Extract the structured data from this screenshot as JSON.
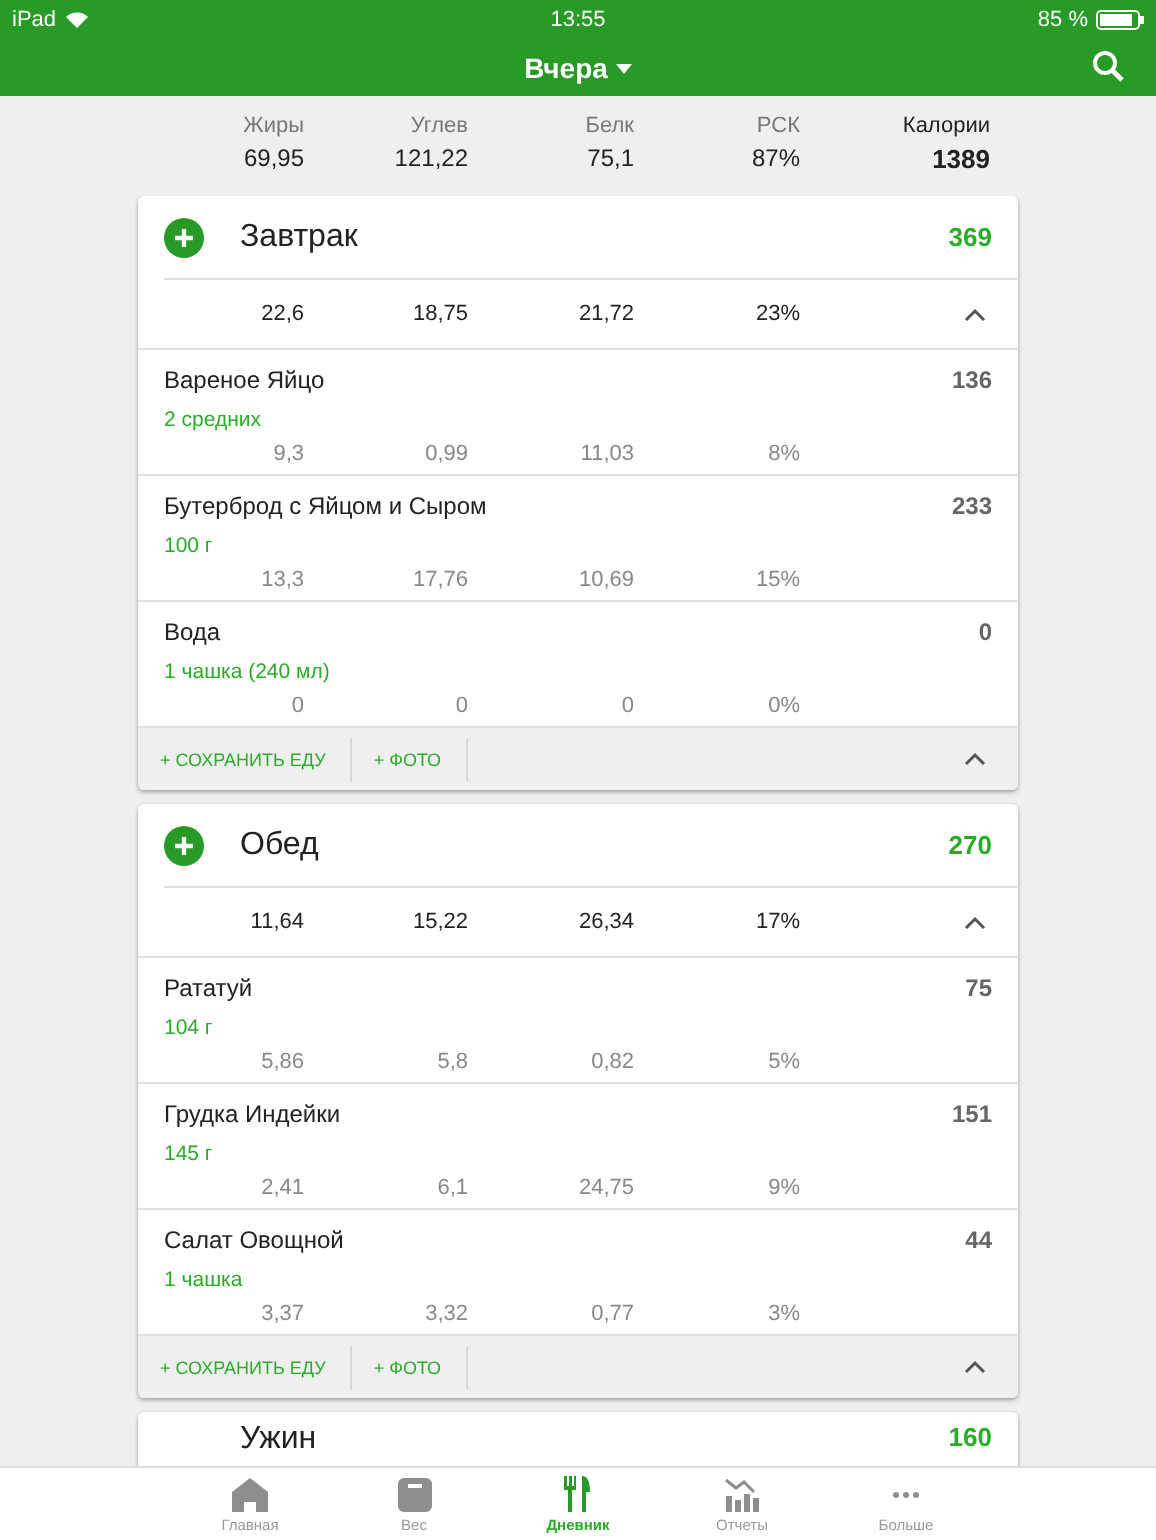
{
  "status_bar": {
    "device": "iPad",
    "time": "13:55",
    "battery": "85 %"
  },
  "header": {
    "title": "Вчера"
  },
  "summary": [
    {
      "kind": "macro",
      "label": "Жиры",
      "value": "69,95"
    },
    {
      "kind": "macro",
      "label": "Углев",
      "value": "121,22"
    },
    {
      "kind": "macro",
      "label": "Белк",
      "value": "75,1"
    },
    {
      "kind": "macro",
      "label": "РСК",
      "value": "87%"
    },
    {
      "kind": "calories",
      "label": "Калории",
      "value": "1389"
    }
  ],
  "meals": [
    {
      "name": "Завтрак",
      "calories": "369",
      "totals": [
        "22,6",
        "18,75",
        "21,72",
        "23%"
      ],
      "expanded": true,
      "items": [
        {
          "name": "Вареное Яйцо",
          "serving": "2 средних",
          "calories": "136",
          "values": [
            "9,3",
            "0,99",
            "11,03",
            "8%"
          ]
        },
        {
          "name": "Бутерброд с Яйцом и Сыром",
          "serving": "100 г",
          "calories": "233",
          "values": [
            "13,3",
            "17,76",
            "10,69",
            "15%"
          ]
        },
        {
          "name": "Вода",
          "serving": "1 чашка (240 мл)",
          "calories": "0",
          "values": [
            "0",
            "0",
            "0",
            "0%"
          ]
        }
      ],
      "actions": [
        "+ СОХРАНИТЬ ЕДУ",
        "+ ФОТО"
      ]
    },
    {
      "name": "Обед",
      "calories": "270",
      "totals": [
        "11,64",
        "15,22",
        "26,34",
        "17%"
      ],
      "expanded": true,
      "items": [
        {
          "name": "Рататуй",
          "serving": "104 г",
          "calories": "75",
          "values": [
            "5,86",
            "5,8",
            "0,82",
            "5%"
          ]
        },
        {
          "name": "Грудка Индейки",
          "serving": "145 г",
          "calories": "151",
          "values": [
            "2,41",
            "6,1",
            "24,75",
            "9%"
          ]
        },
        {
          "name": "Салат Овощной",
          "serving": "1 чашка",
          "calories": "44",
          "values": [
            "3,37",
            "3,32",
            "0,77",
            "3%"
          ]
        }
      ],
      "actions": [
        "+ СОХРАНИТЬ ЕДУ",
        "+ ФОТО"
      ]
    },
    {
      "name": "Ужин",
      "calories": "160"
    }
  ],
  "tab_bar": [
    {
      "kind": "home",
      "label": "Главная",
      "selected": false
    },
    {
      "kind": "scale",
      "label": "Вес",
      "selected": false
    },
    {
      "kind": "diary",
      "label": "Дневник",
      "selected": true
    },
    {
      "kind": "reports",
      "label": "Отчеты",
      "selected": false
    },
    {
      "kind": "more",
      "label": "Больше",
      "selected": false
    }
  ]
}
